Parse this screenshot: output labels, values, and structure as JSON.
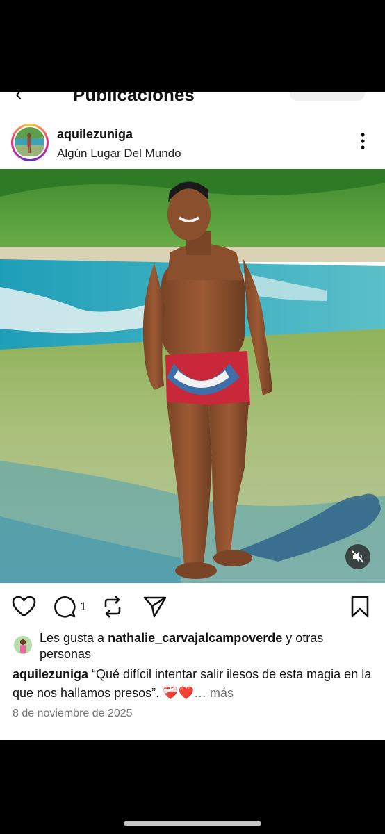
{
  "header": {
    "back_icon": "back-arrow-icon",
    "title": "Publicaciones"
  },
  "post": {
    "username": "aquilezuniga",
    "location": "Algún Lugar Del Mundo",
    "more_icon": "more-vertical-icon",
    "mute_icon": "speaker-muted-icon",
    "actions": {
      "like_icon": "heart-icon",
      "comment_icon": "comment-icon",
      "comment_count": "1",
      "repost_icon": "repost-icon",
      "share_icon": "send-icon",
      "save_icon": "bookmark-icon"
    },
    "likes": {
      "prefix": "Les gusta a ",
      "user": "nathalie_carvajalcampoverde",
      "suffix": " y otras personas"
    },
    "caption": {
      "user": "aquilezuniga",
      "text": " “Qué difícil intentar salir ilesos de esta magia en la que nos hallamos presos”. ",
      "emoji": "❤️‍🩹❤️",
      "more": "… más"
    },
    "date": "8 de noviembre de 2025"
  },
  "colors": {
    "text": "#111111",
    "muted": "#737373",
    "background": "#ffffff",
    "system_bars": "#000000"
  }
}
